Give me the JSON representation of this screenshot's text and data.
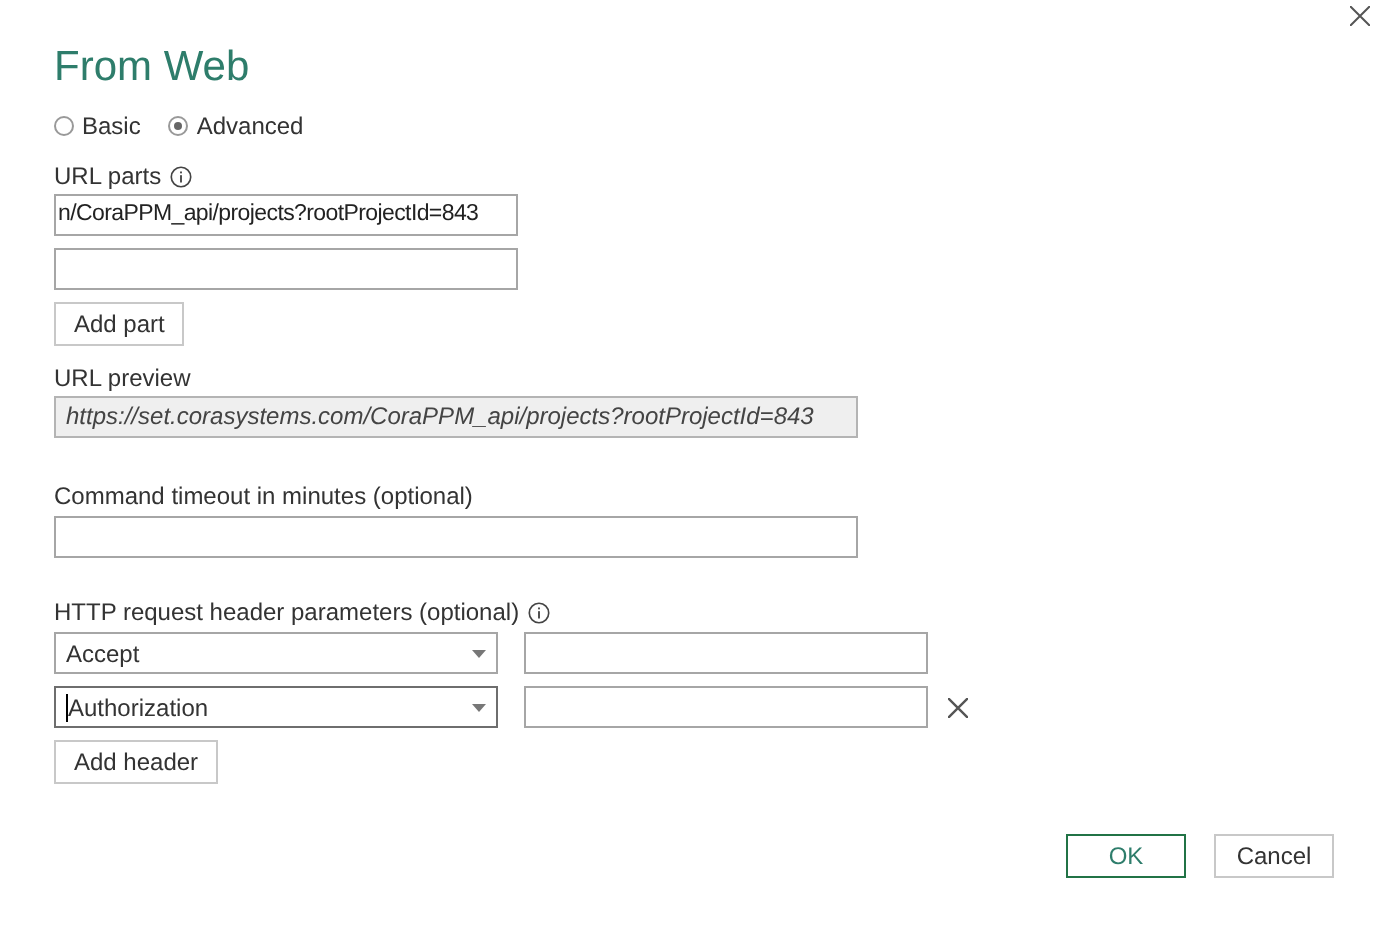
{
  "dialog": {
    "title": "From Web"
  },
  "mode_options": [
    {
      "label": "Basic",
      "selected": false
    },
    {
      "label": "Advanced",
      "selected": true
    }
  ],
  "url_parts": {
    "label": "URL parts",
    "value": "n/CoraPPM_api/projects?rootProjectId=843",
    "add_button": "Add part"
  },
  "url_preview": {
    "label": "URL preview",
    "value": "https://set.corasystems.com/CoraPPM_api/projects?rootProjectId=843"
  },
  "command_timeout": {
    "label": "Command timeout in minutes (optional)"
  },
  "headers": {
    "label": "HTTP request header parameters (optional)",
    "rows": [
      {
        "name": "Accept",
        "focused": false,
        "removable": false
      },
      {
        "name": "Authorization",
        "focused": true,
        "removable": true
      }
    ],
    "add_button": "Add header"
  },
  "buttons": [
    {
      "label": "OK",
      "kind": "primary"
    },
    {
      "label": "Cancel",
      "kind": "secondary"
    }
  ]
}
